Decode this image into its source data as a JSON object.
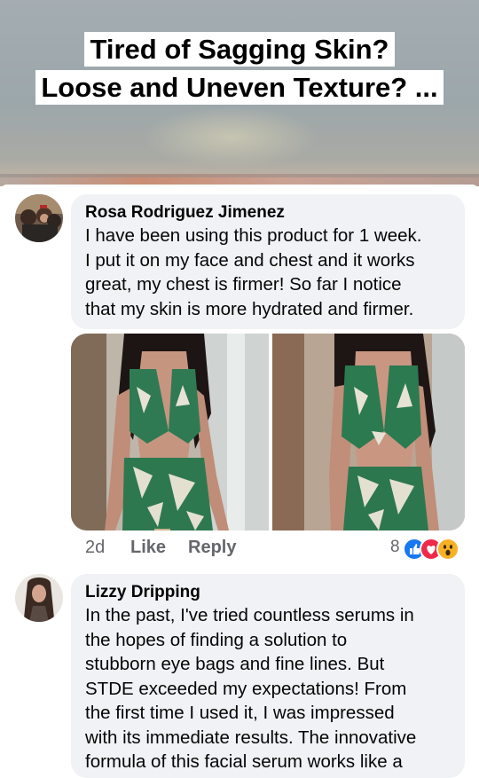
{
  "headline": {
    "line1": "Tired of Sagging Skin?",
    "line2": "Loose and Uneven Texture? ..."
  },
  "comments": [
    {
      "author": "Rosa Rodriguez Jimenez",
      "lines": [
        "I have been using this product for 1 week.",
        "I put it on my face and chest and it works",
        "great, my chest is firmer! So far I notice",
        "that my skin is more hydrated and firmer."
      ],
      "time": "2d",
      "like_label": "Like",
      "reply_label": "Reply",
      "reaction_count": "8",
      "reaction_icons": [
        "like-icon",
        "love-icon",
        "wow-icon"
      ]
    },
    {
      "author": "Lizzy Dripping",
      "lines": [
        "In the past, I've tried countless serums in",
        "the hopes of finding a solution to",
        "stubborn eye bags and fine lines. But",
        "STDE exceeded my expectations! From",
        "the first time I used it, I was impressed",
        "with its immediate results. The innovative",
        "formula of this facial serum works like a"
      ]
    }
  ],
  "colors": {
    "bubble": "#f0f2f5",
    "meta_text": "#65676b",
    "like_blue": "#1877f2",
    "love_red": "#f02849",
    "wow_yellow": "#f7b125"
  }
}
